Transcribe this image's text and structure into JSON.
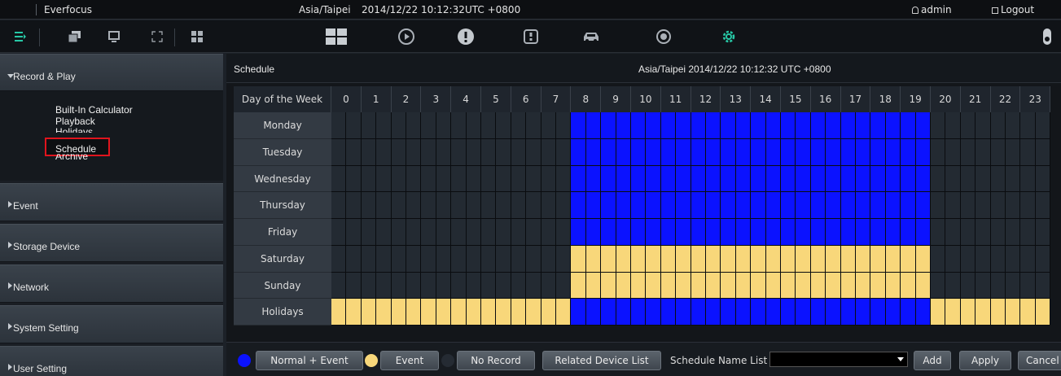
{
  "topbar": {
    "brand": "Everfocus",
    "timezone": "Asia/Taipei",
    "datetime": "2014/12/22 10:12:32",
    "utc": "UTC +0800",
    "user": "admin",
    "logout": "Logout"
  },
  "toolbar": {
    "left_icons": [
      "list-view-icon",
      "layers-icon",
      "monitor-icon",
      "fullscreen-icon",
      "layout-icon"
    ],
    "center_icons": [
      "live-grid-icon",
      "playback-icon",
      "alert-icon",
      "info-icon",
      "vehicle-icon",
      "device-icon",
      "settings-gear-icon"
    ],
    "right_icon": "lock-icon",
    "active_icon": "settings-gear-icon",
    "accent_color": "#27c8a6"
  },
  "sidebar": {
    "sections": [
      {
        "label": "Record & Play",
        "expanded": true
      },
      {
        "label": "Event",
        "expanded": false
      },
      {
        "label": "Storage Device",
        "expanded": false
      },
      {
        "label": "Network",
        "expanded": false
      },
      {
        "label": "System Setting",
        "expanded": false
      },
      {
        "label": "User Setting",
        "expanded": false
      }
    ],
    "submenu": [
      "Built-In Calculator",
      "Playback",
      "Holidays",
      "Schedule",
      "Archive"
    ],
    "selected_submenu": "Schedule"
  },
  "schedule": {
    "title": "Schedule",
    "timestamp": "Asia/Taipei 2014/12/22 10:12:32 UTC +0800",
    "day_header": "Day of the Week",
    "hours": [
      "0",
      "1",
      "2",
      "3",
      "4",
      "5",
      "6",
      "7",
      "8",
      "9",
      "10",
      "11",
      "12",
      "13",
      "14",
      "15",
      "16",
      "17",
      "18",
      "19",
      "20",
      "21",
      "22",
      "23"
    ],
    "rows": [
      {
        "day": "Monday",
        "pattern": "xxxxxxxxxxxxxxxxnnnnnnnnnnnnnnnnnnnnnnnnxxxxxxxxxx"
      },
      {
        "day": "Tuesday",
        "pattern": "xxxxxxxxxxxxxxxxnnnnnnnnnnnnnnnnnnnnnnnnxxxxxxxxxx"
      },
      {
        "day": "Wednesday",
        "pattern": "xxxxxxxxxxxxxxxxnnnnnnnnnnnnnnnnnnnnnnnnxxxxxxxxxx"
      },
      {
        "day": "Thursday",
        "pattern": "xxxxxxxxxxxxxxxxnnnnnnnnnnnnnnnnnnnnnnnnxxxxxxxxxx"
      },
      {
        "day": "Friday",
        "pattern": "xxxxxxxxxxxxxxxxnnnnnnnnnnnnnnnnnnnnnnnnxxxxxxxxxx"
      },
      {
        "day": "Saturday",
        "pattern": "xxxxxxxxxxxxxxxxeeeeeeeeeeeeeeeeeeeeeeeexxxxxxxxxx"
      },
      {
        "day": "Sunday",
        "pattern": "xxxxxxxxxxxxxxxxeeeeeeeeeeeeeeeeeeeeeeeexxxxxxxxxx"
      },
      {
        "day": "Holidays",
        "pattern": "eeeeeeeeeeeeeeeennnnnnnnnnnnnnnnnnnnnnnneeeeeeeeee"
      }
    ],
    "colors": {
      "normal_event": "#0b12ff",
      "event": "#f8d77a",
      "no_record": "#232a32"
    }
  },
  "bottombar": {
    "normal_event": "Normal + Event",
    "event": "Event",
    "no_record": "No Record",
    "related_device_list": "Related Device List",
    "schedule_name_list": "Schedule Name List",
    "schedule_name_value": "",
    "add": "Add",
    "apply": "Apply",
    "cancel": "Cancel"
  }
}
